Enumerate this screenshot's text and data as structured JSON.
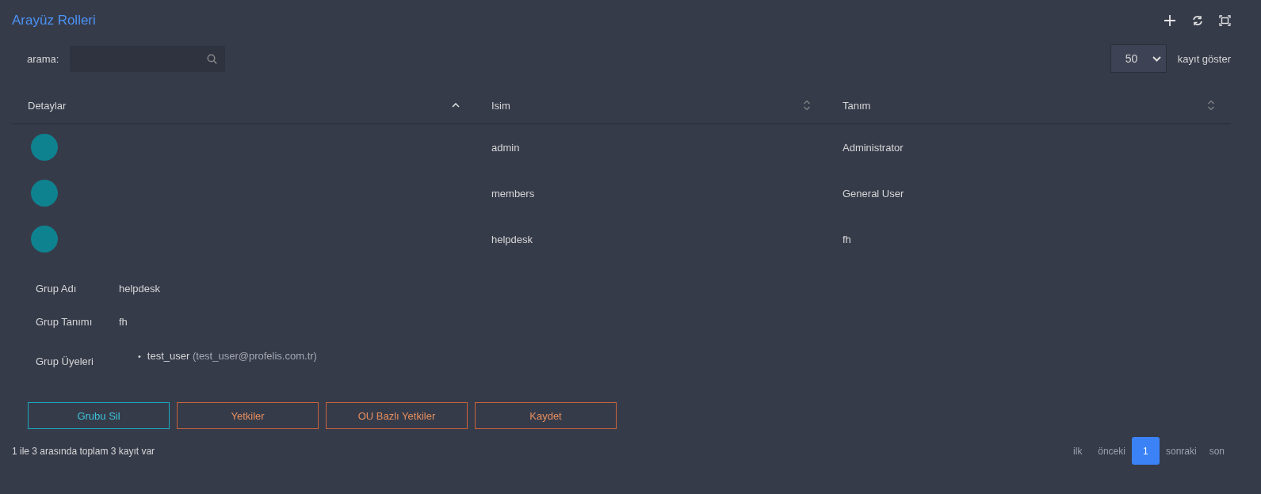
{
  "title": "Arayüz Rolleri",
  "search": {
    "label": "arama:"
  },
  "page_size": {
    "value": "50",
    "label": "kayıt göster"
  },
  "table": {
    "columns": [
      {
        "label": "Detaylar",
        "sorted": true
      },
      {
        "label": "Isim",
        "sorted": false
      },
      {
        "label": "Tanım",
        "sorted": false
      }
    ],
    "rows": [
      {
        "name": "admin",
        "description": "Administrator"
      },
      {
        "name": "members",
        "description": "General User"
      },
      {
        "name": "helpdesk",
        "description": "fh"
      }
    ]
  },
  "detail": {
    "fields": [
      {
        "label": "Grup Adı",
        "value": "helpdesk"
      },
      {
        "label": "Grup Tanımı",
        "value": "fh"
      }
    ],
    "members_label": "Grup Üyeleri",
    "members": [
      {
        "marker": "•",
        "name": "test_user",
        "email": "(test_user@profelis.com.tr)"
      }
    ],
    "buttons": [
      {
        "label": "Grubu Sil",
        "kind": "danger"
      },
      {
        "label": "Yetkiler",
        "kind": "warning"
      },
      {
        "label": "OU Bazlı Yetkiler",
        "kind": "warning"
      },
      {
        "label": "Kaydet",
        "kind": "warning"
      }
    ]
  },
  "footer": "1 ile 3 arasında toplam 3 kayıt var",
  "pagination": [
    {
      "label": "ilk",
      "selected": false
    },
    {
      "label": "önceki",
      "selected": false
    },
    {
      "label": "1",
      "selected": true
    },
    {
      "label": "sonraki",
      "selected": false
    },
    {
      "label": "son",
      "selected": false
    }
  ]
}
